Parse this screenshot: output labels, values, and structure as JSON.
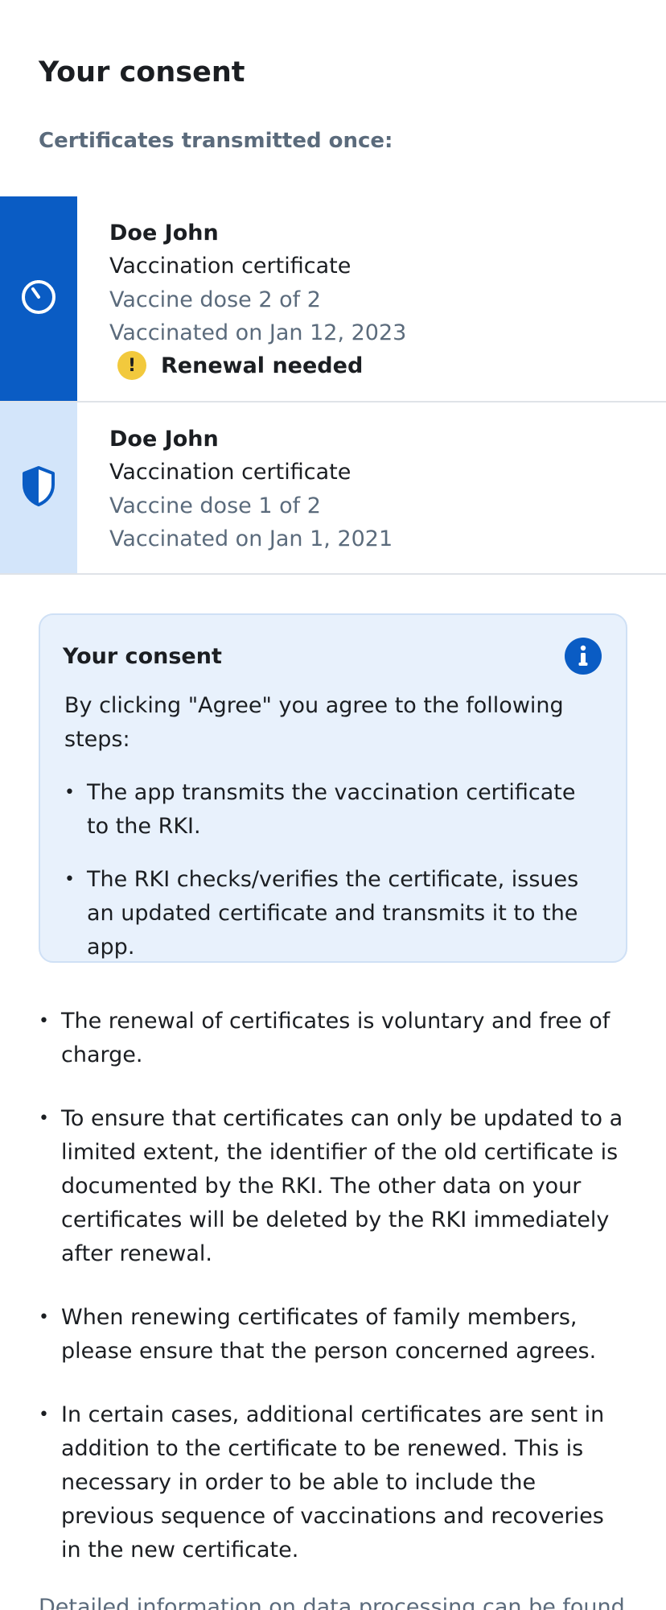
{
  "page": {
    "title": "Your consent",
    "subtitle": "Certificates transmitted once:"
  },
  "certificates": [
    {
      "name": "Doe John",
      "type": "Vaccination certificate",
      "dose": "Vaccine dose 2 of 2",
      "date": "Vaccinated on Jan 12, 2023",
      "status": "Renewal needed",
      "status_icon": "warning-icon",
      "side_icon": "timer-icon",
      "side_color": "#0a5cc4"
    },
    {
      "name": "Doe John",
      "type": "Vaccination certificate",
      "dose": "Vaccine dose 1 of 2",
      "date": "Vaccinated on Jan 1, 2021",
      "side_icon": "shield-icon",
      "side_color": "#d3e5fa"
    }
  ],
  "consent_box": {
    "title": "Your consent",
    "intro": "By clicking \"Agree\" you agree to the following steps:",
    "items": [
      "The app transmits the vaccination certificate to the RKI.",
      "The RKI checks/verifies the certificate, issues an updated certificate and transmits it to the app."
    ],
    "icon": "info-icon"
  },
  "notes": [
    "The renewal of certificates is voluntary and free of charge.",
    "To ensure that certificates can only be updated to a limited extent, the identifier of the old certificate is documented by the RKI. The other data on your certificates will be deleted by the RKI immediately after renewal.",
    "When renewing certificates of family members, please ensure that the person concerned agrees.",
    "In certain cases, additional certificates are sent in addition to the certificate to be renewed. This is necessary in order to be able to include the previous sequence of vaccinations and recoveries in the new certificate."
  ],
  "footer_text": "Detailed information on data processing can be found",
  "colors": {
    "accent": "#0a5cc4",
    "warning": "#f2c93d",
    "muted_text": "#5b6b7c",
    "info_box_bg": "#e8f1fc"
  }
}
